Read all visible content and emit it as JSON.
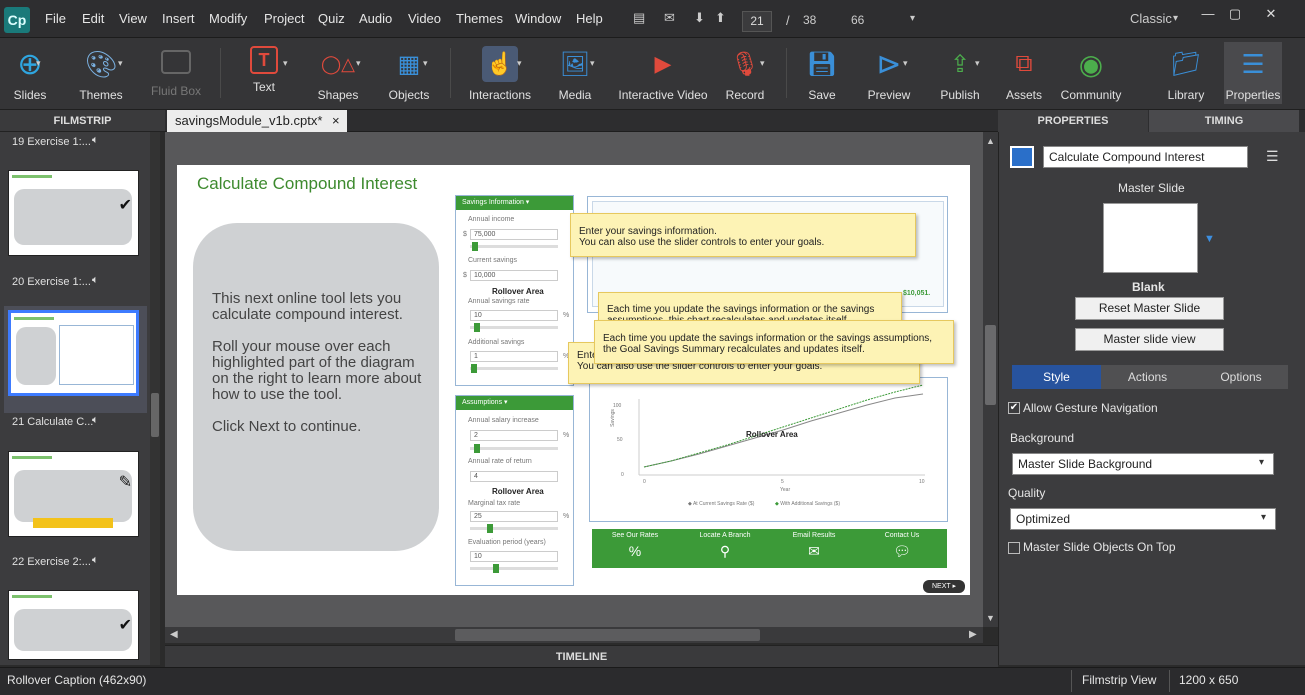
{
  "app": {
    "logo": "Cp"
  },
  "menu": [
    "File",
    "Edit",
    "View",
    "Insert",
    "Modify",
    "Project",
    "Quiz",
    "Audio",
    "Video",
    "Themes",
    "Window",
    "Help"
  ],
  "nav": {
    "current_slide": "21",
    "separator": "/",
    "total_slides": "38",
    "zoom": "66"
  },
  "workspace": {
    "mode": "Classic"
  },
  "toolbar": [
    {
      "label": "Slides",
      "icon": "plus-circle-icon",
      "color": "#2fa6e0"
    },
    {
      "label": "Themes",
      "icon": "palette-icon",
      "color": "#7ab0e0"
    },
    {
      "label": "Fluid Box",
      "icon": "fluid-box-icon",
      "color": "#777"
    },
    {
      "label": "Text",
      "icon": "text-t-icon",
      "color": "#e04a3c"
    },
    {
      "label": "Shapes",
      "icon": "shapes-icon",
      "color": "#e04a3c"
    },
    {
      "label": "Objects",
      "icon": "objects-grid-icon",
      "color": "#3a8fd8"
    },
    {
      "label": "Interactions",
      "icon": "hand-pointer-icon",
      "color": "#3a8fd8"
    },
    {
      "label": "Media",
      "icon": "image-icon",
      "color": "#3a8fd8"
    },
    {
      "label": "Interactive Video",
      "icon": "video-play-icon",
      "color": "#e04a3c"
    },
    {
      "label": "Record",
      "icon": "microphone-icon",
      "color": "#e04a3c"
    },
    {
      "label": "Save",
      "icon": "save-disk-icon",
      "color": "#3a8fd8"
    },
    {
      "label": "Preview",
      "icon": "play-circle-icon",
      "color": "#3a8fd8"
    },
    {
      "label": "Publish",
      "icon": "publish-icon",
      "color": "#4cae4c"
    },
    {
      "label": "Assets",
      "icon": "assets-icon",
      "color": "#e04a3c"
    },
    {
      "label": "Community",
      "icon": "community-icon",
      "color": "#4cae4c"
    },
    {
      "label": "Library",
      "icon": "library-folder-icon",
      "color": "#3a8fd8"
    },
    {
      "label": "Properties",
      "icon": "properties-list-icon",
      "color": "#3a8fd8"
    }
  ],
  "filmstrip": {
    "title": "FILMSTRIP",
    "items": [
      {
        "label": "19 Exercise 1:..."
      },
      {
        "label": "20 Exercise 1:..."
      },
      {
        "label": "21 Calculate C..."
      },
      {
        "label": "22 Exercise 2:..."
      }
    ]
  },
  "document_tab": {
    "name": "savingsModule_v1b.cptx*",
    "close": "×"
  },
  "slide": {
    "title": "Calculate Compound Interest",
    "bubble_p1": "This next online tool lets you calculate compound interest.",
    "bubble_p2": "Roll your mouse over each highlighted part of the diagram on the right to learn more about how to use the tool.",
    "bubble_p3": "Click Next to continue.",
    "savings_panel": {
      "header": "Savings Information ▾",
      "annual_income": "Annual income",
      "annual_income_value": "75,000",
      "current_savings": "Current savings",
      "current_savings_value": "10,000",
      "annual_savings_rate": "Annual savings rate",
      "annual_savings_rate_value": "10",
      "additional_savings": "Additional savings",
      "additional_savings_value": "1",
      "currency": "$",
      "percent": "%"
    },
    "assumptions_panel": {
      "header": "Assumptions ▾",
      "salary_increase": "Annual salary increase",
      "salary_increase_value": "2",
      "rate_of_return": "Annual rate of return",
      "rate_of_return_value": "4",
      "marginal_tax": "Marginal tax rate",
      "marginal_tax_value": "25",
      "evaluation_period": "Evaluation period (years)",
      "evaluation_period_value": "10",
      "percent": "%"
    },
    "rollover_label": "Rollover Area",
    "caption1": "Enter your savings information.\nYou can also use the slider controls to enter your goals.",
    "caption2": "Each time you update the savings information or the savings assumptions, this chart recalculates and updates itself.",
    "caption3": "Each time you update the savings information or the savings assumptions, the Goal Savings Summary recalculates and updates itself.",
    "caption4_prefix": "Ente",
    "caption4": "You can also use the slider controls to enter your goals.",
    "summary_value": "$10,051.",
    "chart_legend1": "At Current Savings Rate ($)",
    "chart_legend2": "With Additional Savings ($)",
    "chart_ylabel": "Savings",
    "chart_xlabel": "Year",
    "footer": [
      {
        "label": "See Our Rates",
        "icon": "percent-icon"
      },
      {
        "label": "Locate A Branch",
        "icon": "magnifier-icon"
      },
      {
        "label": "Email Results",
        "icon": "envelope-icon"
      },
      {
        "label": "Contact Us",
        "icon": "speech-bubble-icon"
      }
    ],
    "next_label": "NEXT ▸"
  },
  "timeline": {
    "title": "TIMELINE"
  },
  "properties": {
    "tabs": [
      "PROPERTIES",
      "TIMING"
    ],
    "object_name": "Calculate Compound Interest",
    "master_slide_label": "Master Slide",
    "master_slide_name": "Blank",
    "reset_button": "Reset Master Slide",
    "view_button": "Master slide view",
    "sub_tabs": [
      "Style",
      "Actions",
      "Options"
    ],
    "allow_gesture": "Allow Gesture Navigation",
    "background_label": "Background",
    "background_value": "Master Slide Background",
    "quality_label": "Quality",
    "quality_value": "Optimized",
    "objects_on_top": "Master Slide Objects On Top"
  },
  "status": {
    "left": "Rollover Caption (462x90)",
    "view": "Filmstrip View",
    "size": "1200 x 650"
  },
  "colors": {
    "brand_green": "#3c9a38",
    "accent_blue": "#3d7bff",
    "caption_yellow": "#fdf3b5"
  }
}
